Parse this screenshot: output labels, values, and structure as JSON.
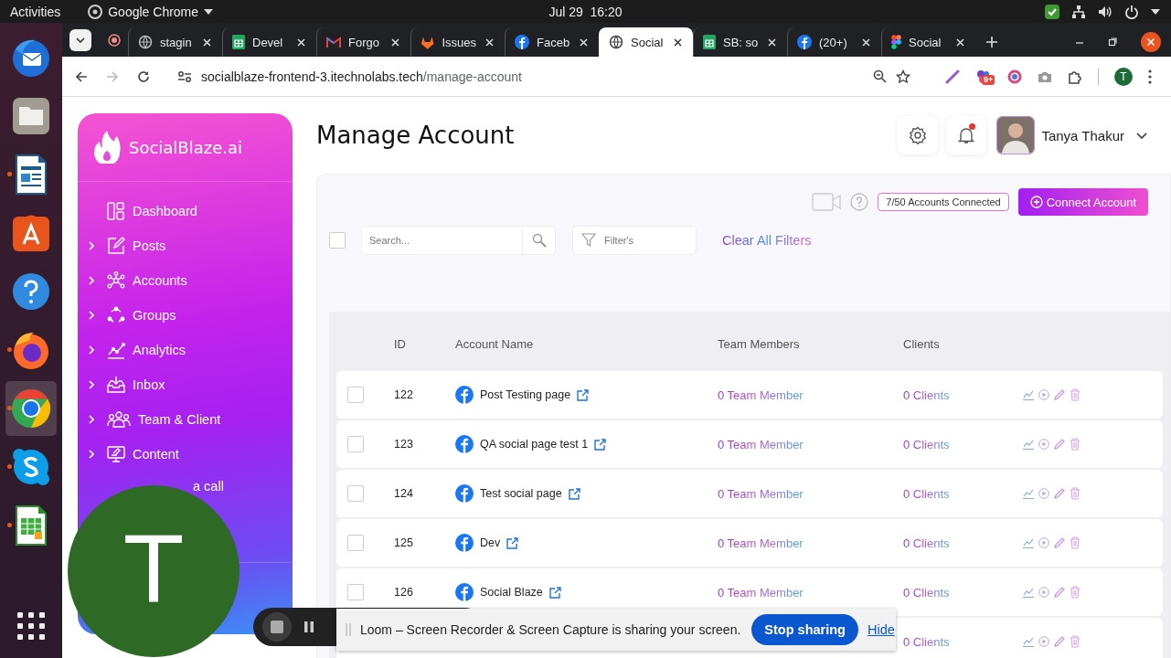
{
  "top_bar": {
    "activities": "Activities",
    "app_menu": "Google Chrome",
    "clock": "Jul 29  16:20"
  },
  "dock": [
    {
      "kind": "mail",
      "running": false,
      "selected": false
    },
    {
      "kind": "files",
      "running": false,
      "selected": false
    },
    {
      "kind": "writer",
      "running": true,
      "selected": false
    },
    {
      "kind": "store",
      "running": false,
      "selected": false
    },
    {
      "kind": "help",
      "running": false,
      "selected": false
    },
    {
      "kind": "firefox",
      "running": true,
      "selected": false
    },
    {
      "kind": "chrome",
      "running": true,
      "selected": true
    },
    {
      "kind": "skype",
      "running": true,
      "selected": false
    },
    {
      "kind": "calc",
      "running": true,
      "selected": false
    }
  ],
  "browser": {
    "tabs": [
      {
        "kind": "globe",
        "title": "stagin",
        "selected": false
      },
      {
        "kind": "sheet",
        "title": "Devel",
        "selected": false
      },
      {
        "kind": "mail",
        "title": "Forgo",
        "selected": false
      },
      {
        "kind": "fox",
        "title": "Issues",
        "selected": false
      },
      {
        "kind": "facebook",
        "title": "Faceb",
        "selected": false
      },
      {
        "kind": "globe",
        "title": "Social",
        "selected": true
      },
      {
        "kind": "sheet",
        "title": "SB: so",
        "selected": false
      },
      {
        "kind": "facebook",
        "title": "(20+)",
        "selected": false
      },
      {
        "kind": "figma",
        "title": "Social",
        "selected": false
      }
    ],
    "url_host": "socialblaze-frontend-3.itechnolabs.tech",
    "url_path": "/manage-account",
    "extensions": [
      {
        "kind": "pen"
      },
      {
        "kind": "badge",
        "badge": "9+"
      },
      {
        "kind": "ring"
      },
      {
        "kind": "camera"
      },
      {
        "kind": "puzzle"
      }
    ],
    "profile_initial": "T"
  },
  "sidebar": {
    "logo": "SocialBlaze.ai",
    "items": [
      {
        "label": "Dashboard",
        "kind": "dashboard",
        "expandable": false
      },
      {
        "label": "Posts",
        "kind": "posts",
        "expandable": true
      },
      {
        "label": "Accounts",
        "kind": "accounts",
        "expandable": true
      },
      {
        "label": "Groups",
        "kind": "groups",
        "expandable": true
      },
      {
        "label": "Analytics",
        "kind": "analytics",
        "expandable": true
      },
      {
        "label": "Inbox",
        "kind": "inbox",
        "expandable": true
      },
      {
        "label": "Team & Client",
        "kind": "team",
        "expandable": true
      },
      {
        "label": "Content",
        "kind": "content",
        "expandable": true
      },
      {
        "label": "a call",
        "kind": "partial",
        "expandable": false
      }
    ]
  },
  "header": {
    "title": "Manage Account",
    "user_name": "Tanya Thakur",
    "has_notification": true
  },
  "toolbar": {
    "accounts_connected": "7/50 Accounts Connected",
    "connect_button": "Connect Account",
    "search": {
      "placeholder": "Search..."
    },
    "filter": {
      "placeholder": "Filter's"
    },
    "clear_filters": "Clear All Filters",
    "select_all_checked": false
  },
  "table": {
    "columns": [
      "ID",
      "Account Name",
      "Team Members",
      "Clients"
    ],
    "rows": [
      {
        "id": "122",
        "kind": "facebook",
        "name": "Post Testing page",
        "team_members": "0 Team Member",
        "clients": "0 Clients",
        "checked": false
      },
      {
        "id": "123",
        "kind": "facebook",
        "name": "QA social page test 1",
        "team_members": "0 Team Member",
        "clients": "0 Clients",
        "checked": false
      },
      {
        "id": "124",
        "kind": "facebook",
        "name": "Test social page",
        "team_members": "0 Team Member",
        "clients": "0 Clients",
        "checked": false
      },
      {
        "id": "125",
        "kind": "facebook",
        "name": "Dev",
        "team_members": "0 Team Member",
        "clients": "0 Clients",
        "checked": false
      },
      {
        "id": "126",
        "kind": "facebook",
        "name": "Social Blaze",
        "team_members": "0 Team Member",
        "clients": "0 Clients",
        "checked": false
      },
      {
        "clients": "0 Clients"
      }
    ]
  },
  "loom": {
    "camera_initial": "T",
    "message": "Loom – Screen Recorder & Screen Capture is sharing your screen.",
    "stop_button": "Stop sharing",
    "hide_link": "Hide"
  }
}
